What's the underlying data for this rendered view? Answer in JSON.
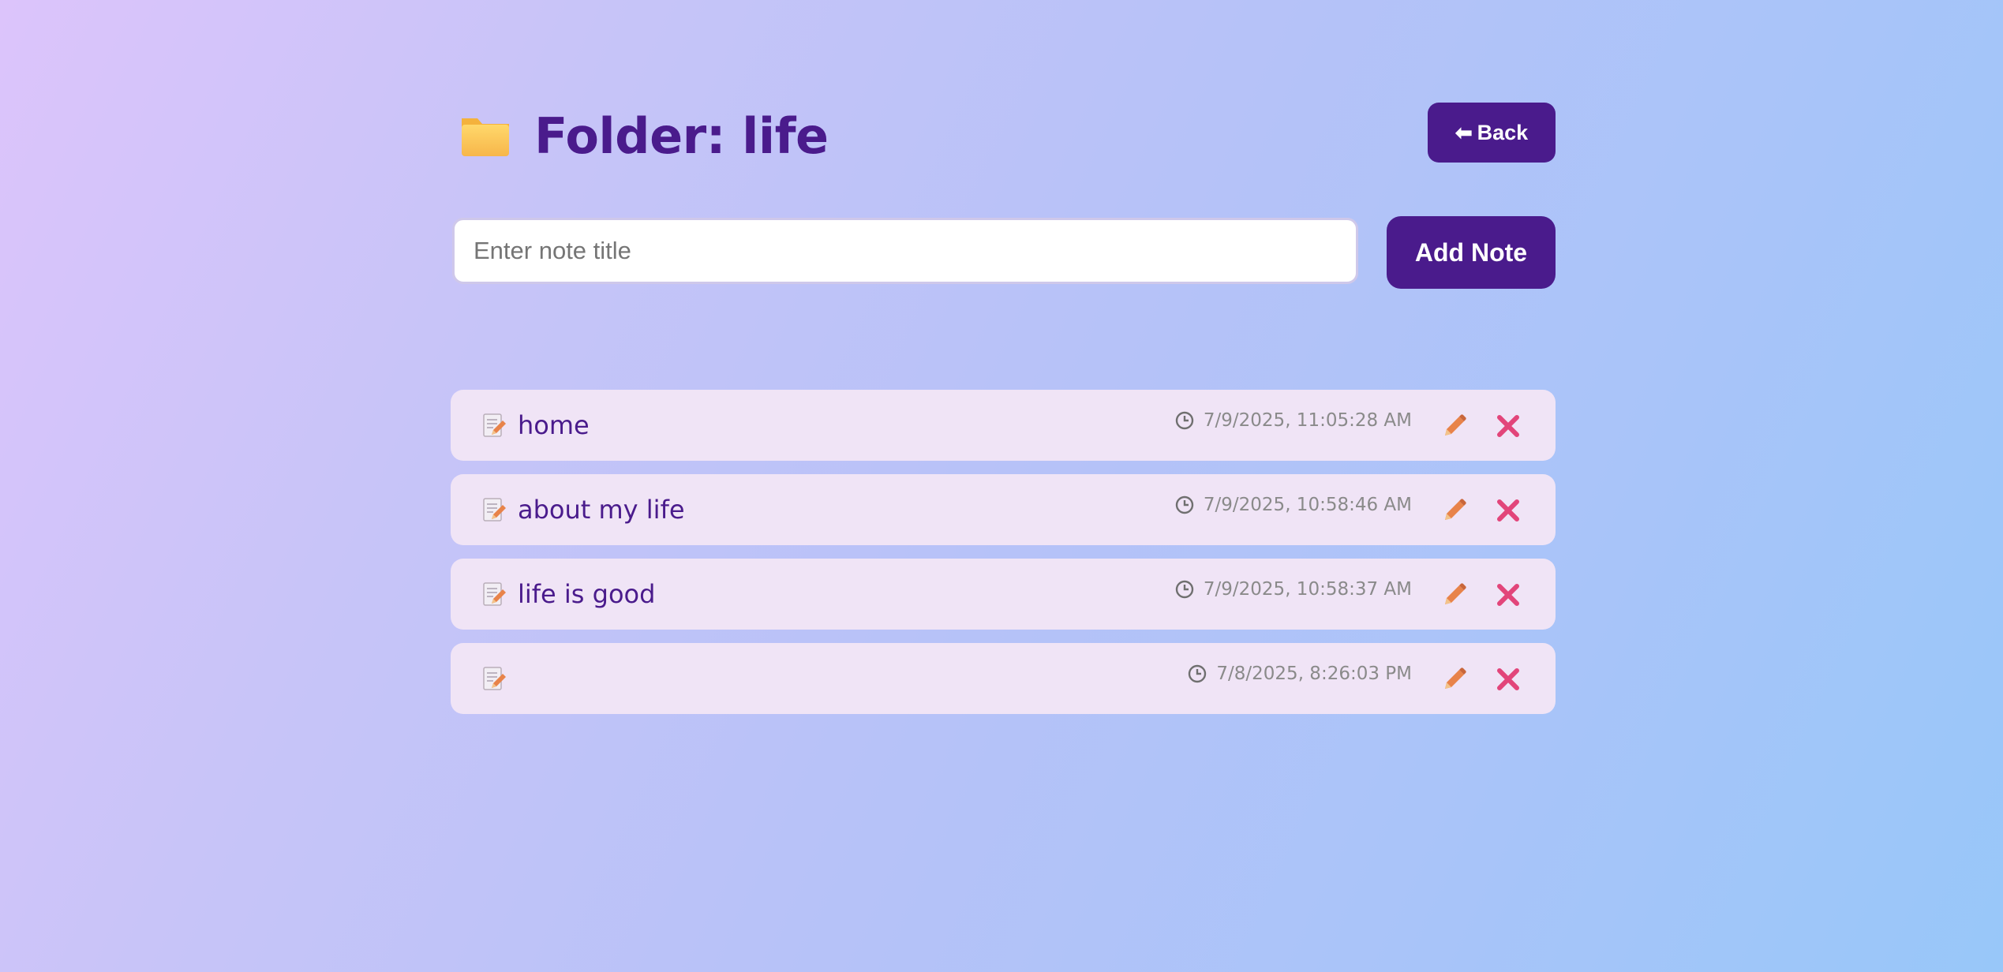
{
  "header": {
    "folder_icon": "folder-icon",
    "title": "Folder: life",
    "back_label": "Back",
    "back_icon": "left-arrow-icon"
  },
  "add_note": {
    "placeholder": "Enter note title",
    "value": "",
    "button_label": "Add Note"
  },
  "notes": [
    {
      "title": "home",
      "timestamp": "7/9/2025, 11:05:28 AM"
    },
    {
      "title": "about my life",
      "timestamp": "7/9/2025, 10:58:46 AM"
    },
    {
      "title": "life is good",
      "timestamp": "7/9/2025, 10:58:37 AM"
    },
    {
      "title": "",
      "timestamp": "7/8/2025, 8:26:03 PM"
    }
  ],
  "icons": {
    "note": "memo-icon",
    "timestamp": "clock-icon",
    "edit": "pencil-icon",
    "delete": "cross-icon"
  },
  "colors": {
    "accent": "#4a1b8c",
    "note_background": "#f0e4f6",
    "edit_icon": "#e8834a",
    "delete_icon": "#e2457a"
  }
}
